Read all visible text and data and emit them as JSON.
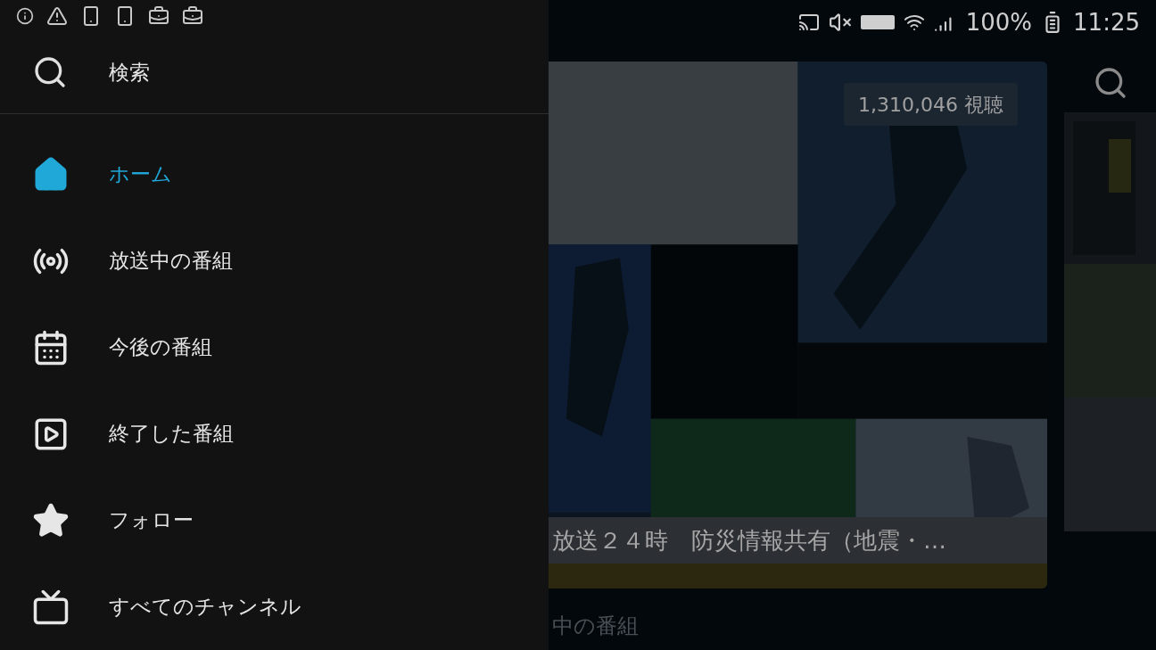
{
  "status_bar": {
    "battery": "100%",
    "time": "11:25"
  },
  "drawer": {
    "search": {
      "label": "検索"
    },
    "items": [
      {
        "kind": "home",
        "label": "ホーム",
        "selected": true
      },
      {
        "kind": "live",
        "label": "放送中の番組",
        "selected": false
      },
      {
        "kind": "upcoming",
        "label": "今後の番組",
        "selected": false
      },
      {
        "kind": "ended",
        "label": "終了した番組",
        "selected": false
      },
      {
        "kind": "follow",
        "label": "フォロー",
        "selected": false
      },
      {
        "kind": "channels",
        "label": "すべてのチャンネル",
        "selected": false
      }
    ]
  },
  "content": {
    "viewer_count": "1,310,046 視聴",
    "card_title": "放送２４時　防災情報共有（地震・…",
    "section_heading": "中の番組"
  }
}
